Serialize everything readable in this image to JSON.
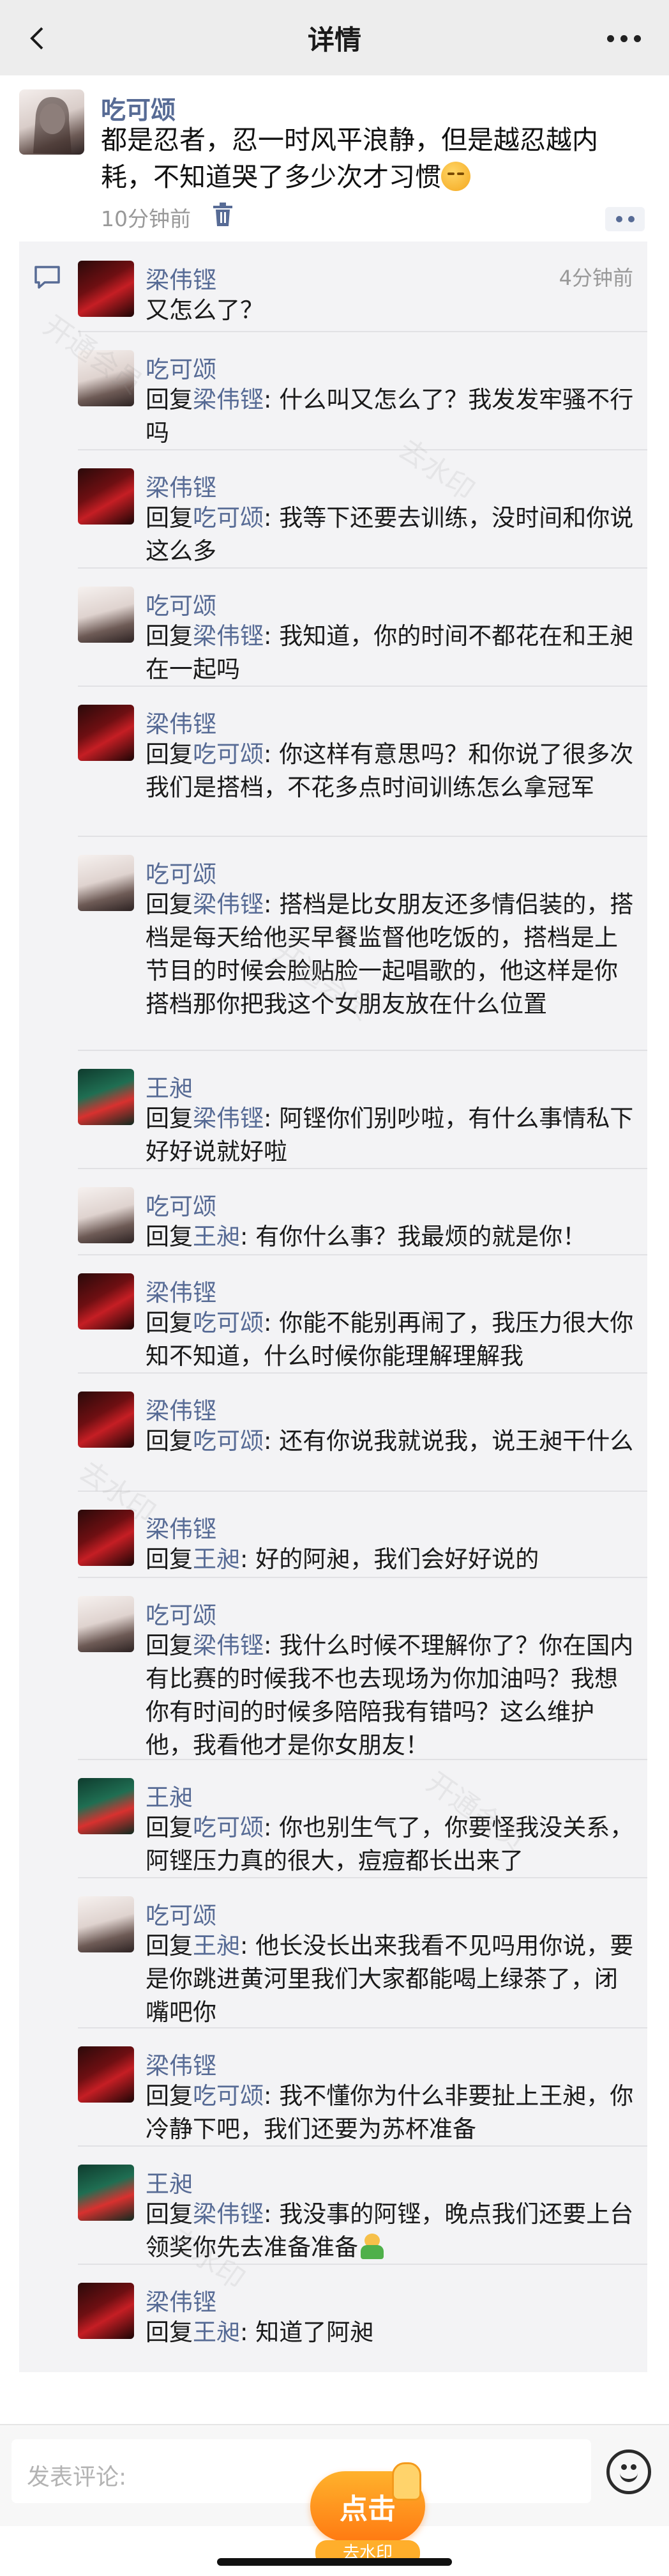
{
  "nav": {
    "title": "详情",
    "back_icon": "chevron-left-icon",
    "more_icon": "more-dots-icon"
  },
  "post": {
    "author": "吃可颂",
    "text": "都是忍者，忍一时风平浪静，但是越忍越内耗，不知道哭了多少次才习惯",
    "emoji": "pensive-face",
    "time": "10分钟前"
  },
  "comments": [
    {
      "name": "梁伟铿",
      "time": "4分钟前",
      "reply_prefix": "",
      "reply_to": "",
      "sep": "",
      "text": "又怎么了？"
    },
    {
      "name": "吃可颂",
      "reply_prefix": "回复",
      "reply_to": "梁伟铿",
      "sep": ": ",
      "text": "什么叫又怎么了？我发发牢骚不行吗"
    },
    {
      "name": "梁伟铿",
      "reply_prefix": "回复",
      "reply_to": "吃可颂",
      "sep": ": ",
      "text": "我等下还要去训练，没时间和你说这么多"
    },
    {
      "name": "吃可颂",
      "reply_prefix": "回复",
      "reply_to": "梁伟铿",
      "sep": ": ",
      "text": "我知道，你的时间不都花在和王昶在一起吗"
    },
    {
      "name": "梁伟铿",
      "reply_prefix": "回复",
      "reply_to": "吃可颂",
      "sep": ": ",
      "text": "你这样有意思吗？和你说了很多次我们是搭档，不花多点时间训练怎么拿冠军"
    },
    {
      "name": "吃可颂",
      "reply_prefix": "回复",
      "reply_to": "梁伟铿",
      "sep": ": ",
      "text": "搭档是比女朋友还多情侣装的，搭档是每天给他买早餐监督他吃饭的，搭档是上节目的时候会脸贴脸一起唱歌的，他这样是你搭档那你把我这个女朋友放在什么位置"
    },
    {
      "name": "王昶",
      "reply_prefix": "回复",
      "reply_to": "梁伟铿",
      "sep": ": ",
      "text": "阿铿你们别吵啦，有什么事情私下好好说就好啦"
    },
    {
      "name": "吃可颂",
      "reply_prefix": "回复",
      "reply_to": "王昶",
      "sep": ": ",
      "text": "有你什么事？我最烦的就是你！"
    },
    {
      "name": "梁伟铿",
      "reply_prefix": "回复",
      "reply_to": "吃可颂",
      "sep": ": ",
      "text": "你能不能别再闹了，我压力很大你知不知道，什么时候你能理解理解我"
    },
    {
      "name": "梁伟铿",
      "reply_prefix": "回复",
      "reply_to": "吃可颂",
      "sep": ": ",
      "text": "还有你说我就说我，说王昶干什么"
    },
    {
      "name": "梁伟铿",
      "reply_prefix": "回复",
      "reply_to": "王昶",
      "sep": ": ",
      "text": "好的阿昶，我们会好好说的"
    },
    {
      "name": "吃可颂",
      "reply_prefix": "回复",
      "reply_to": "梁伟铿",
      "sep": ": ",
      "text": "我什么时候不理解你了？你在国内有比赛的时候我不也去现场为你加油吗？我想你有时间的时候多陪陪我有错吗？这么维护他，我看他才是你女朋友！"
    },
    {
      "name": "王昶",
      "reply_prefix": "回复",
      "reply_to": "吃可颂",
      "sep": ": ",
      "text": "你也别生气了，你要怪我没关系，阿铿压力真的很大，痘痘都长出来了"
    },
    {
      "name": "吃可颂",
      "reply_prefix": "回复",
      "reply_to": "王昶",
      "sep": ": ",
      "text": "他长没长出来我看不见吗用你说，要是你跳进黄河里我们大家都能喝上绿茶了，闭嘴吧你"
    },
    {
      "name": "梁伟铿",
      "reply_prefix": "回复",
      "reply_to": "吃可颂",
      "sep": ": ",
      "text": "我不懂你为什么非要扯上王昶，你冷静下吧，我们还要为苏杯准备"
    },
    {
      "name": "王昶",
      "reply_prefix": "回复",
      "reply_to": "梁伟铿",
      "sep": ": ",
      "text": "我没事的阿铿，晚点我们还要上台领奖你先去准备准备"
    },
    {
      "name": "梁伟铿",
      "reply_prefix": "回复",
      "reply_to": "王昶",
      "sep": ": ",
      "text": "知道了阿昶"
    }
  ],
  "input": {
    "placeholder": "发表评论:",
    "emoji_icon": "smile-icon"
  },
  "promo": {
    "label": "点击",
    "sub": "去水印"
  },
  "watermark": {
    "a": "开通会员",
    "b": "去水印"
  }
}
